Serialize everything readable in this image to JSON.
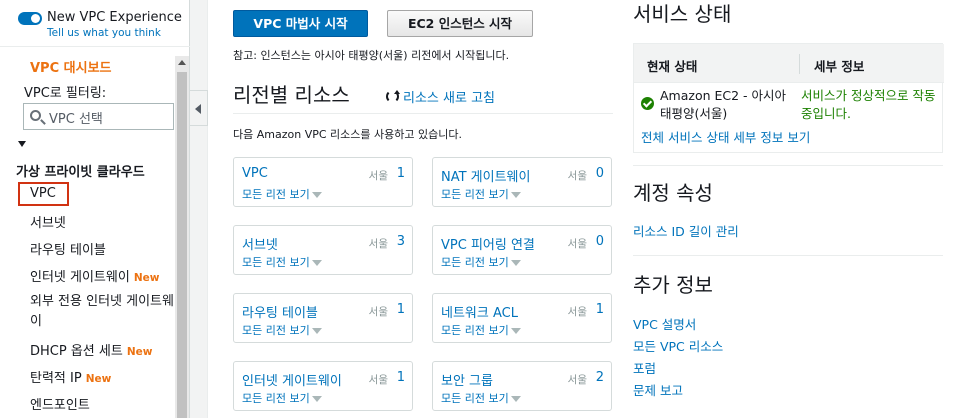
{
  "sidebar": {
    "toggle_title": "New VPC Experience",
    "toggle_link": "Tell us what you think",
    "dashboard": "VPC 대시보드",
    "filter_label": "VPC로 필터링:",
    "filter_placeholder": "VPC 선택",
    "section": "가상 프라이빗 클라우드",
    "items": [
      {
        "label": "VPC",
        "active": true
      },
      {
        "label": "서브넷"
      },
      {
        "label": "라우팅 테이블"
      },
      {
        "label": "인터넷 게이트웨이",
        "badge": "New"
      },
      {
        "label": "외부 전용 인터넷 게이트웨이"
      },
      {
        "label": "DHCP 옵션 세트",
        "badge": "New"
      },
      {
        "label": "탄력적 IP",
        "badge": "New"
      },
      {
        "label": "엔드포인트"
      }
    ]
  },
  "actions": {
    "vpc_wizard": "VPC 마법사 시작",
    "ec2_launch": "EC2 인스턴스 시작",
    "note": "참고: 인스턴스는 아시아 태평양(서울) 리전에서 시작됩니다."
  },
  "resources": {
    "title": "리전별 리소스",
    "refresh": "리소스 새로 고침",
    "using": "다음 Amazon VPC 리소스를 사용하고 있습니다.",
    "view_all": "모든 리전 보기",
    "cards": [
      {
        "name": "VPC",
        "region": "서울",
        "count": "1"
      },
      {
        "name": "NAT 게이트웨이",
        "region": "서울",
        "count": "0"
      },
      {
        "name": "서브넷",
        "region": "서울",
        "count": "3"
      },
      {
        "name": "VPC 피어링 연결",
        "region": "서울",
        "count": "0"
      },
      {
        "name": "라우팅 테이블",
        "region": "서울",
        "count": "1"
      },
      {
        "name": "네트워크 ACL",
        "region": "서울",
        "count": "1"
      },
      {
        "name": "인터넷 게이트웨이",
        "region": "서울",
        "count": "1"
      },
      {
        "name": "보안 그룹",
        "region": "서울",
        "count": "2"
      }
    ]
  },
  "service_health": {
    "title": "서비스 상태",
    "col_status": "현재 상태",
    "col_detail": "세부 정보",
    "service": "Amazon EC2 - 아시아 태평양(서울)",
    "detail": "서비스가 정상적으로 작동 중입니다.",
    "all_link": "전체 서비스 상태 세부 정보 보기"
  },
  "account": {
    "title": "계정 속성",
    "link": "리소스 ID 길이 관리"
  },
  "more_info": {
    "title": "추가 정보",
    "links": [
      "VPC 설명서",
      "모든 VPC 리소스",
      "포럼",
      "문제 보고"
    ]
  },
  "colors": {
    "accent": "#0073bb",
    "orange": "#ec7211",
    "ok": "#1d8102",
    "highlight_border": "#d13212"
  }
}
